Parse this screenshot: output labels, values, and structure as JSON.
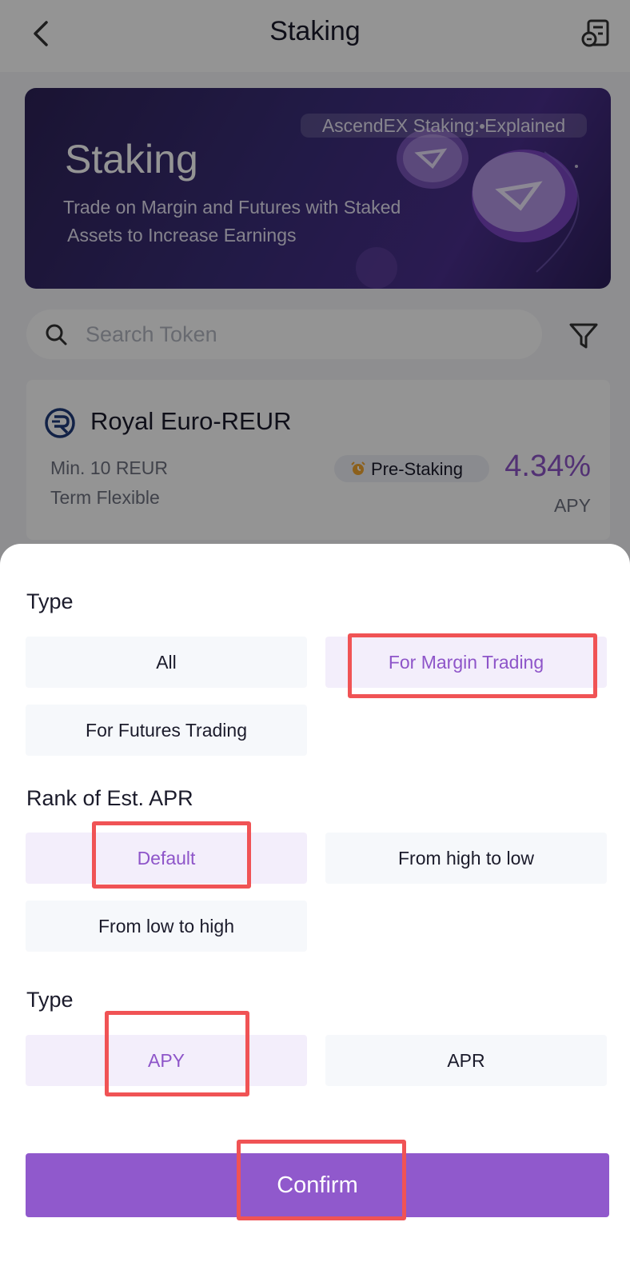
{
  "header": {
    "title": "Staking"
  },
  "banner": {
    "link_label": "AscendEX Staking: Explained",
    "title": "Staking",
    "subtitle_line1": "Trade on Margin and Futures with Staked",
    "subtitle_line2": " Assets to Increase Earnings"
  },
  "search": {
    "placeholder": "Search Token"
  },
  "token": {
    "name": "Royal Euro-REUR",
    "min": "Min. 10 REUR",
    "term": "Term Flexible",
    "badge": "Pre-Staking",
    "rate": "4.34%",
    "rate_label": "APY"
  },
  "filter_sheet": {
    "type_title": "Type",
    "type_options": [
      "All",
      "For Margin Trading",
      "For Futures Trading"
    ],
    "type_selected": "For Margin Trading",
    "rank_title": "Rank of Est. APR",
    "rank_options": [
      "Default",
      "From high to low",
      "From low to high"
    ],
    "rank_selected": "Default",
    "rate_type_title": "Type",
    "rate_type_options": [
      "APY",
      "APR"
    ],
    "rate_type_selected": "APY",
    "confirm_label": "Confirm"
  },
  "colors": {
    "accent": "#9059cc",
    "highlight": "#f05355"
  }
}
